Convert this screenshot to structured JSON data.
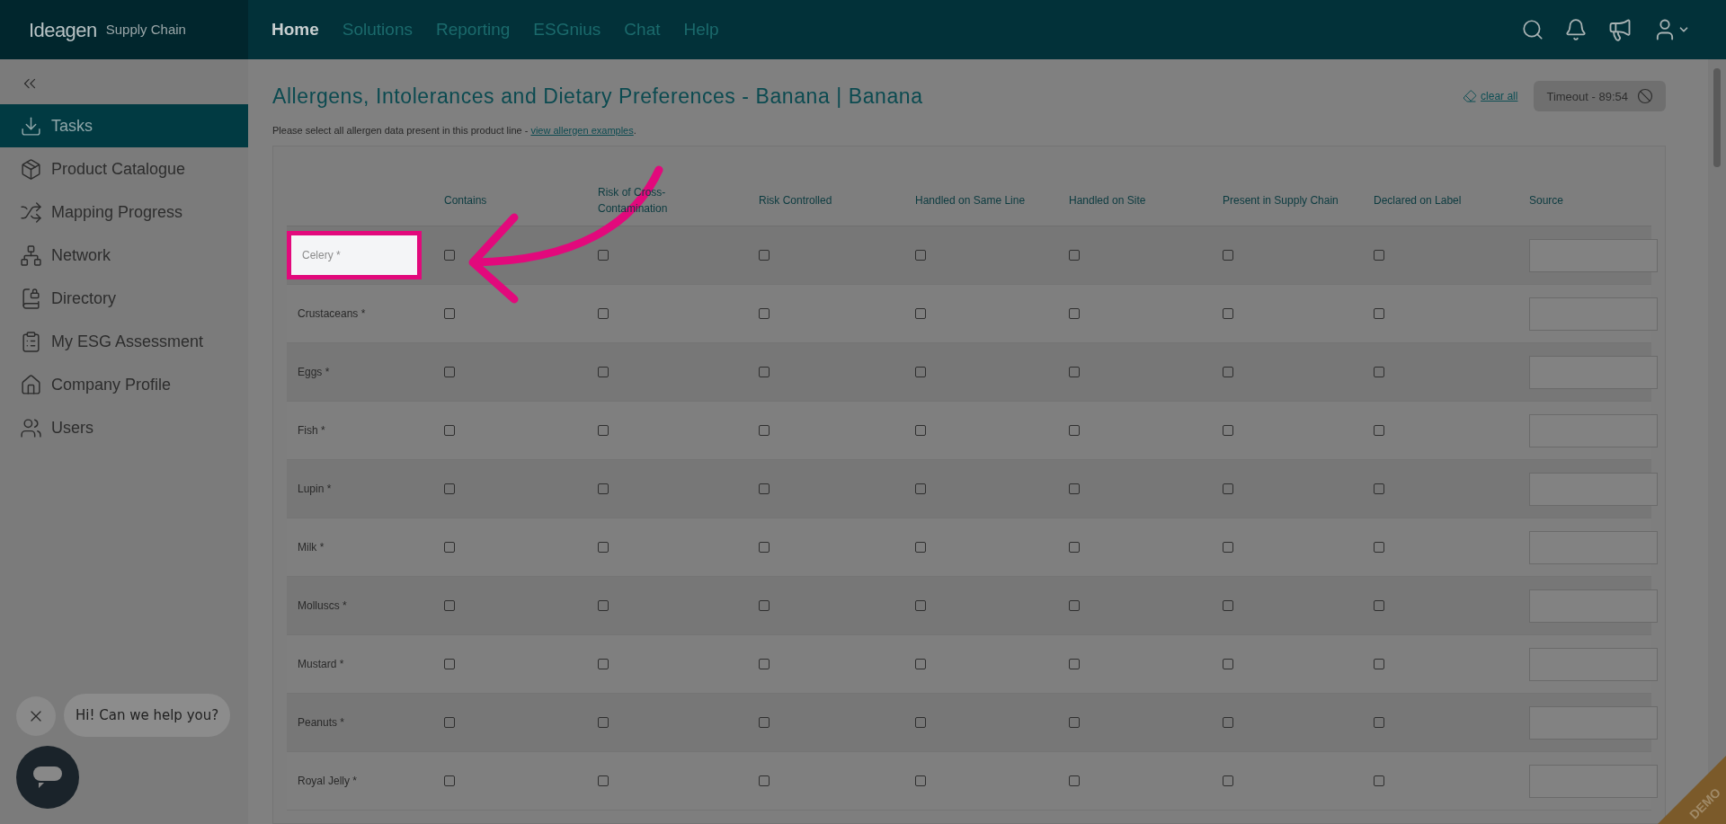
{
  "brand": {
    "name": "Ideagen",
    "product": "Supply Chain"
  },
  "nav": [
    {
      "label": "Home",
      "selected": true
    },
    {
      "label": "Solutions",
      "selected": false
    },
    {
      "label": "Reporting",
      "selected": false
    },
    {
      "label": "ESGnius",
      "selected": false
    },
    {
      "label": "Chat",
      "selected": false
    },
    {
      "label": "Help",
      "selected": false
    }
  ],
  "sidebar": {
    "items": [
      {
        "label": "Tasks",
        "selected": true
      },
      {
        "label": "Product Catalogue",
        "selected": false
      },
      {
        "label": "Mapping Progress",
        "selected": false
      },
      {
        "label": "Network",
        "selected": false
      },
      {
        "label": "Directory",
        "selected": false
      },
      {
        "label": "My ESG Assessment",
        "selected": false
      },
      {
        "label": "Company Profile",
        "selected": false
      },
      {
        "label": "Users",
        "selected": false
      }
    ]
  },
  "page": {
    "title": "Allergens, Intolerances and Dietary Preferences - Banana | Banana",
    "clear_all": "clear all",
    "timeout": "Timeout - 89:54",
    "intro": "Please select all allergen data present in this product line - ",
    "intro_link": "view allergen examples",
    "intro_end": "."
  },
  "table": {
    "columns": [
      "Contains",
      "Risk of Cross-Contamination",
      "Risk Controlled",
      "Handled on Same Line",
      "Handled on Site",
      "Present in Supply Chain",
      "Declared on Label",
      "Source"
    ],
    "rows": [
      {
        "name": "Celery *",
        "highlighted": true,
        "checks": [
          false,
          false,
          false,
          false,
          false,
          false,
          false
        ]
      },
      {
        "name": "Crustaceans *",
        "highlighted": false,
        "checks": [
          false,
          false,
          false,
          false,
          false,
          false,
          false
        ]
      },
      {
        "name": "Eggs *",
        "highlighted": false,
        "checks": [
          false,
          false,
          false,
          false,
          false,
          false,
          false
        ]
      },
      {
        "name": "Fish *",
        "highlighted": false,
        "checks": [
          false,
          false,
          false,
          false,
          false,
          false,
          false
        ]
      },
      {
        "name": "Lupin *",
        "highlighted": false,
        "checks": [
          false,
          false,
          false,
          false,
          false,
          false,
          false
        ]
      },
      {
        "name": "Milk *",
        "highlighted": false,
        "checks": [
          false,
          false,
          false,
          false,
          false,
          false,
          false
        ]
      },
      {
        "name": "Molluscs *",
        "highlighted": false,
        "checks": [
          false,
          false,
          false,
          false,
          false,
          false,
          false
        ]
      },
      {
        "name": "Mustard *",
        "highlighted": false,
        "checks": [
          false,
          false,
          false,
          false,
          false,
          false,
          false
        ]
      },
      {
        "name": "Peanuts *",
        "highlighted": false,
        "checks": [
          false,
          false,
          false,
          false,
          false,
          false,
          false
        ]
      },
      {
        "name": "Royal Jelly *",
        "highlighted": false,
        "checks": [
          false,
          false,
          false,
          false,
          false,
          false,
          false
        ]
      }
    ]
  },
  "chat": {
    "message": "Hi! Can we help you?"
  },
  "demo_ribbon": "DEMO"
}
